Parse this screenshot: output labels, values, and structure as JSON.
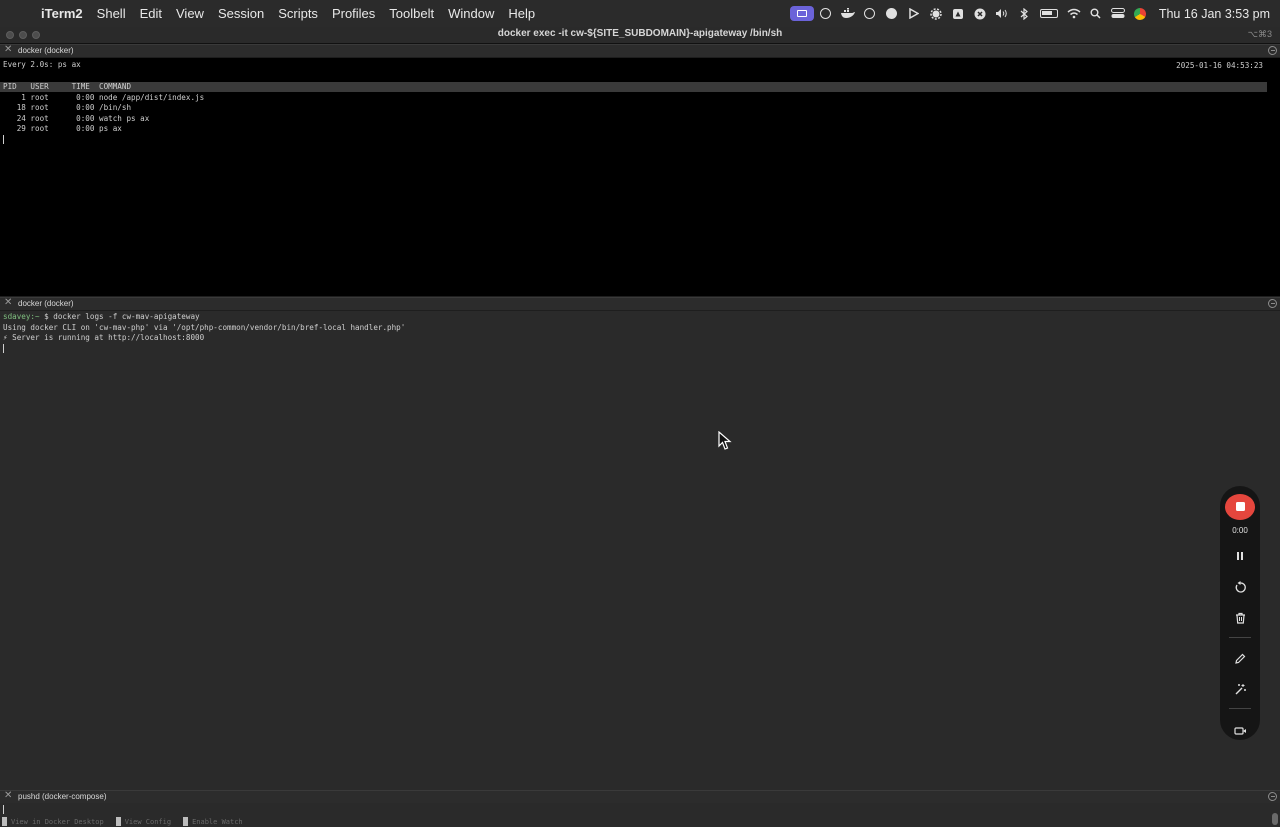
{
  "menubar": {
    "apple": "",
    "app_name": "iTerm2",
    "items": [
      "Shell",
      "Edit",
      "View",
      "Session",
      "Scripts",
      "Profiles",
      "Toolbelt",
      "Window",
      "Help"
    ],
    "clock": "Thu 16 Jan  3:53 pm",
    "status_icons": [
      "screen-record-icon",
      "openai-icon",
      "docker-icon",
      "onepassword-icon",
      "circle-icon",
      "play-icon",
      "gear-icon",
      "drive-icon",
      "close-circle-icon",
      "volume-icon",
      "bluetooth-icon",
      "battery-icon",
      "wifi-icon",
      "search-icon",
      "control-center-icon",
      "chrome-icon"
    ]
  },
  "window": {
    "title": "docker exec -it cw-${SITE_SUBDOMAIN}-apigateway /bin/sh",
    "shortcut": "⌥⌘3"
  },
  "pane1": {
    "tab_title": "docker (docker)",
    "watch_header": "Every 2.0s: ps ax",
    "watch_timestamp": "2025-01-16 04:53:23",
    "ps_header": "PID   USER     TIME  COMMAND",
    "ps_rows": [
      "    1 root      0:00 node /app/dist/index.js",
      "   18 root      0:00 /bin/sh",
      "   24 root      0:00 watch ps ax",
      "   29 root      0:00 ps ax"
    ]
  },
  "pane2": {
    "tab_title": "docker (docker)",
    "prompt_user": "sdavey:~",
    "prompt_cmd": " $ docker logs -f cw-mav-apigateway",
    "lines": [
      "Using docker CLI on 'cw-mav-php' via '/opt/php-common/vendor/bin/bref-local handler.php'",
      "⚡ Server is running at http://localhost:8000"
    ]
  },
  "pane3": {
    "tab_title": "pushd (docker-compose)",
    "hints": [
      "View in Docker Desktop",
      "View Config",
      "Enable Watch"
    ]
  },
  "recorder": {
    "time": "0:00",
    "stop_color": "#e5463d"
  }
}
